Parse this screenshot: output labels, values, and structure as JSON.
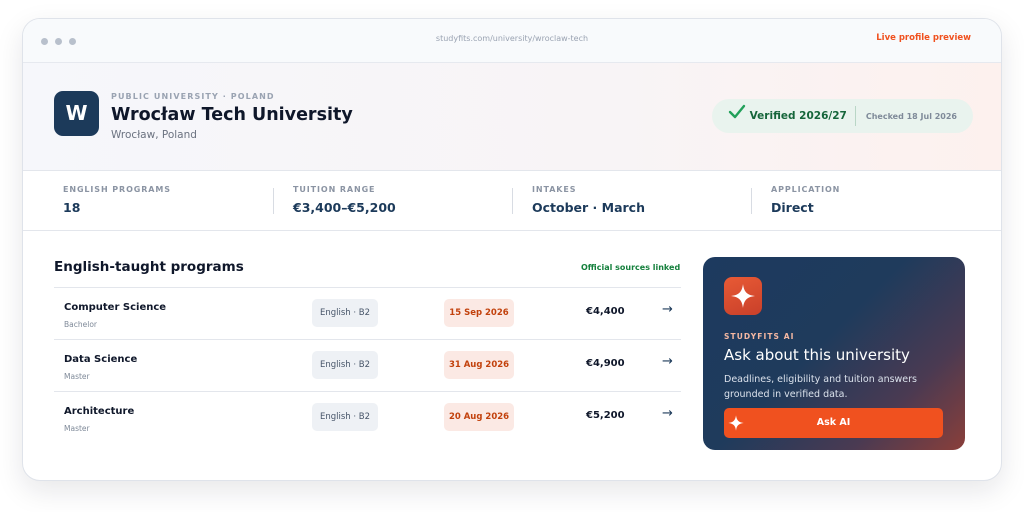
{
  "browser": {
    "url": "studyfits.com/university/wroclaw-tech",
    "preview_link": "Live profile preview"
  },
  "university": {
    "logo_letter": "W",
    "eyebrow": "PUBLIC UNIVERSITY · POLAND",
    "name": "Wrocław Tech University",
    "location": "Wrocław, Poland",
    "verified_label": "Verified 2026/27",
    "checked_label": "Checked 18 Jul 2026"
  },
  "stats": [
    {
      "label": "ENGLISH PROGRAMS",
      "value": "18"
    },
    {
      "label": "TUITION RANGE",
      "value": "€3,400–€5,200"
    },
    {
      "label": "INTAKES",
      "value": "October · March"
    },
    {
      "label": "APPLICATION",
      "value": "Direct"
    }
  ],
  "programs_section": {
    "title": "English-taught programs",
    "sources_label": "Official sources linked",
    "programs": [
      {
        "name": "Computer Science",
        "level": "Bachelor",
        "language": "English · B2",
        "deadline": "15 Sep 2026",
        "price": "€4,400"
      },
      {
        "name": "Data Science",
        "level": "Master",
        "language": "English · B2",
        "deadline": "31 Aug 2026",
        "price": "€4,900"
      },
      {
        "name": "Architecture",
        "level": "Master",
        "language": "English · B2",
        "deadline": "20 Aug 2026",
        "price": "€5,200"
      }
    ]
  },
  "ai_card": {
    "eyebrow": "STUDYFITS AI",
    "title": "Ask about this university",
    "description": "Deadlines, eligibility and tuition answers grounded in verified data.",
    "button_label": "Ask AI"
  },
  "colors": {
    "brand_navy": "#1c3a5a",
    "accent_orange": "#f0511f",
    "verified_green": "#15653a",
    "deadline_red": "#c2410c"
  },
  "icons": {
    "verified": "check-icon",
    "program_row": "arrow-right-icon",
    "ai": "sparkle-icon"
  }
}
